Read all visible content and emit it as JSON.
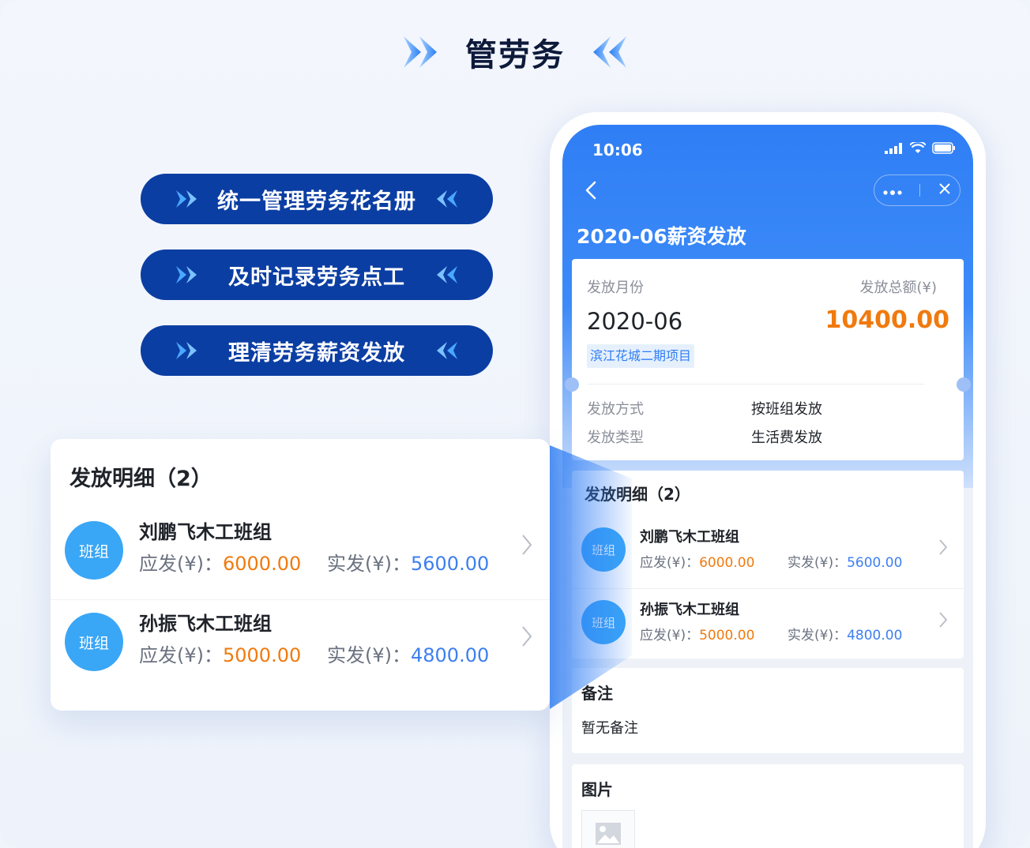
{
  "hero": {
    "title": "管劳务"
  },
  "features": [
    {
      "label": "统一管理劳务花名册"
    },
    {
      "label": "及时记录劳务点工"
    },
    {
      "label": "理清劳务薪资发放"
    }
  ],
  "phone": {
    "status_time": "10:06",
    "page_title": "2020-06薪资发放",
    "summary": {
      "month_label": "发放月份",
      "month_value": "2020-06",
      "total_label": "发放总额(¥)",
      "total_value": "10400.00",
      "project_tag": "滨江花城二期项目",
      "method_label": "发放方式",
      "method_value": "按班组发放",
      "type_label": "发放类型",
      "type_value": "生活费发放"
    },
    "details": {
      "header": "发放明细（2）",
      "rows": [
        {
          "avatar": "班组",
          "name": "刘鹏飞木工班组",
          "due_label": "应发(¥)：",
          "due": "6000.00",
          "paid_label": "实发(¥)：",
          "paid": "5600.00"
        },
        {
          "avatar": "班组",
          "name": "孙振飞木工班组",
          "due_label": "应发(¥)：",
          "due": "5000.00",
          "paid_label": "实发(¥)：",
          "paid": "4800.00"
        }
      ]
    },
    "remark": {
      "header": "备注",
      "content": "暂无备注"
    },
    "pictures": {
      "header": "图片"
    }
  },
  "zoom_card": {
    "header": "发放明细（2）",
    "rows": [
      {
        "avatar": "班组",
        "name": "刘鹏飞木工班组",
        "due_label": "应发(¥)：",
        "due": "6000.00",
        "paid_label": "实发(¥)：",
        "paid": "5600.00"
      },
      {
        "avatar": "班组",
        "name": "孙振飞木工班组",
        "due_label": "应发(¥)：",
        "due": "5000.00",
        "paid_label": "实发(¥)：",
        "paid": "4800.00"
      }
    ]
  },
  "colors": {
    "brand": "#2f7ef5",
    "pill": "#0b3ea3",
    "amount": "#f07a0e",
    "paid": "#3d7ff0",
    "avatar": "#3aa6f6"
  },
  "icons": [
    "double-chevron-right-icon",
    "double-chevron-left-icon",
    "signal-icon",
    "wifi-icon",
    "battery-icon",
    "back-icon",
    "more-icon",
    "close-icon",
    "chevron-right-icon",
    "image-placeholder-icon"
  ]
}
